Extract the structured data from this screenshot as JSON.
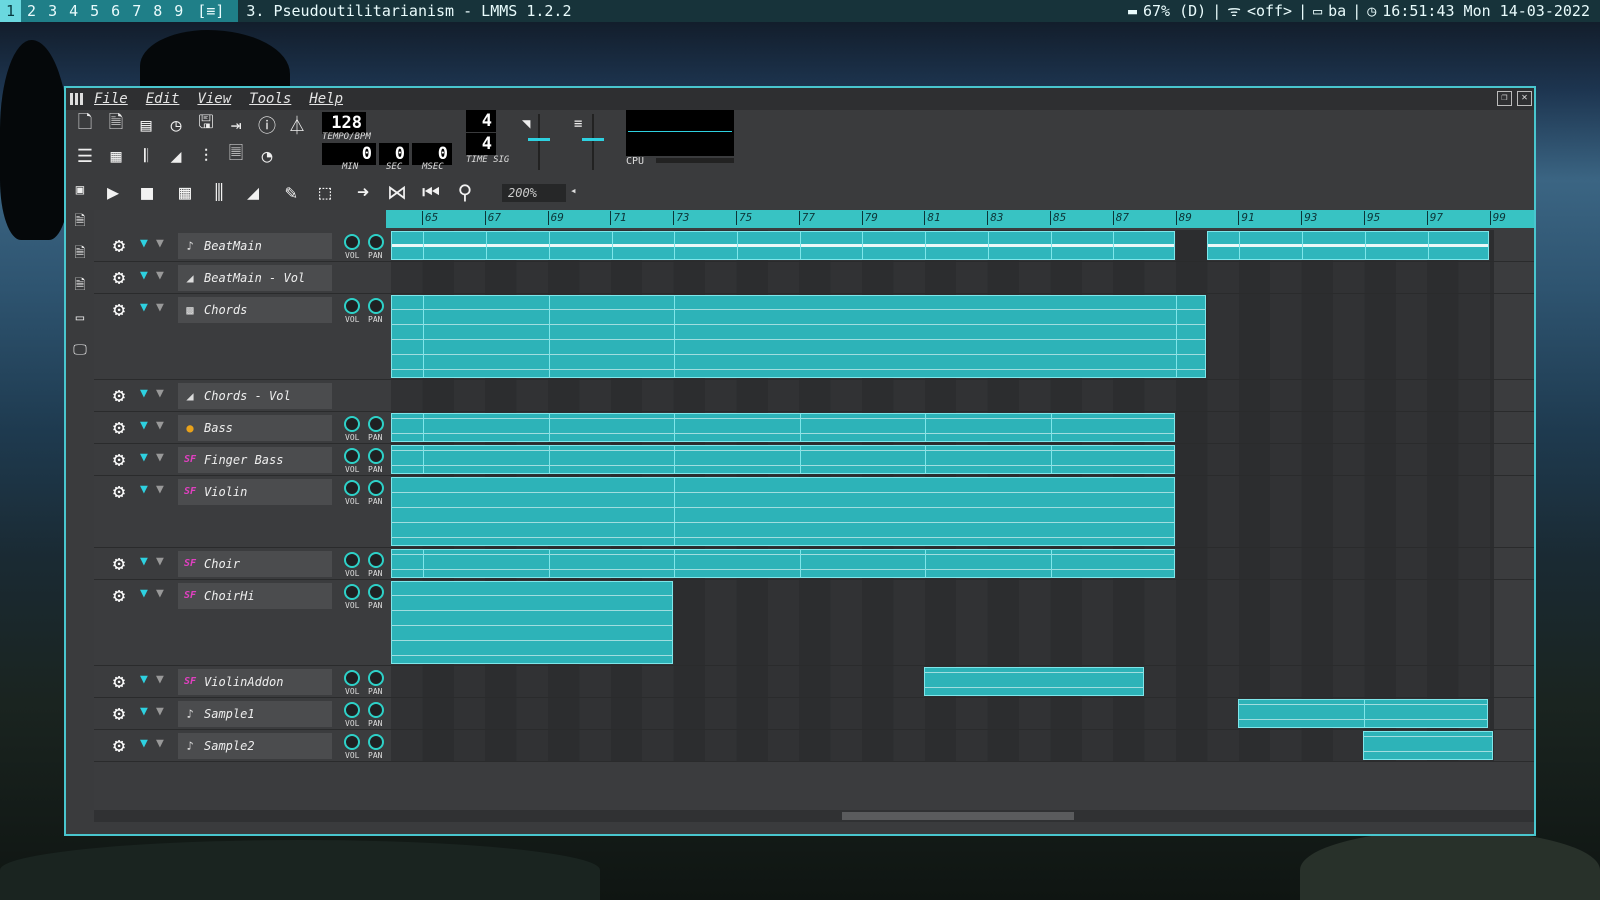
{
  "topbar": {
    "workspaces": [
      "1",
      "2",
      "3",
      "4",
      "5",
      "6",
      "7",
      "8",
      "9"
    ],
    "layout": "[≡]",
    "window_title": "3. Pseudoutilitarianism - LMMS 1.2.2",
    "battery": "67% (D)",
    "wifi": "<off>",
    "keyboard": "ba",
    "clock": "16:51:43 Mon 14-03-2022"
  },
  "menu": {
    "items": [
      "File",
      "Edit",
      "View",
      "Tools",
      "Help"
    ]
  },
  "transport": {
    "tempo": "128",
    "tempo_label": "TEMPO/BPM",
    "min": "0",
    "sec": "0",
    "msec": "0",
    "min_label": "MIN",
    "sec_label": "SEC",
    "msec_label": "MSEC",
    "timesig_num": "4",
    "timesig_den": "4",
    "timesig_label": "TIME SIG",
    "cpu_label": "CPU"
  },
  "editor": {
    "zoom": "200%"
  },
  "ruler": {
    "bars": [
      "65",
      "67",
      "69",
      "71",
      "73",
      "75",
      "77",
      "79",
      "81",
      "83",
      "85",
      "87",
      "89",
      "91",
      "93",
      "95",
      "97",
      "99"
    ]
  },
  "knob_labels": {
    "vol": "VOL",
    "pan": "PAN"
  },
  "tracks": [
    {
      "name": "BeatMain",
      "icon": "note-icon",
      "knobs": true
    },
    {
      "name": "BeatMain - Vol",
      "icon": "automation-icon",
      "knobs": false
    },
    {
      "name": "Chords",
      "icon": "sample-icon",
      "knobs": true
    },
    {
      "name": "Chords - Vol",
      "icon": "automation-icon",
      "knobs": false
    },
    {
      "name": "Bass",
      "icon": "fruit-icon",
      "knobs": true
    },
    {
      "name": "Finger Bass",
      "icon": "sf2-icon",
      "knobs": true
    },
    {
      "name": "Violin",
      "icon": "sf2-icon",
      "knobs": true
    },
    {
      "name": "Choir",
      "icon": "sf2-icon",
      "knobs": true
    },
    {
      "name": "ChoirHi",
      "icon": "sf2-icon",
      "knobs": true
    },
    {
      "name": "ViolinAddon",
      "icon": "sf2-icon",
      "knobs": true
    },
    {
      "name": "Sample1",
      "icon": "note-icon",
      "knobs": true
    },
    {
      "name": "Sample2",
      "icon": "note-icon",
      "knobs": true
    }
  ],
  "colors": {
    "accent": "#2fb6bc",
    "ruler": "#38c3c3",
    "topbar": "#1f7f88"
  }
}
